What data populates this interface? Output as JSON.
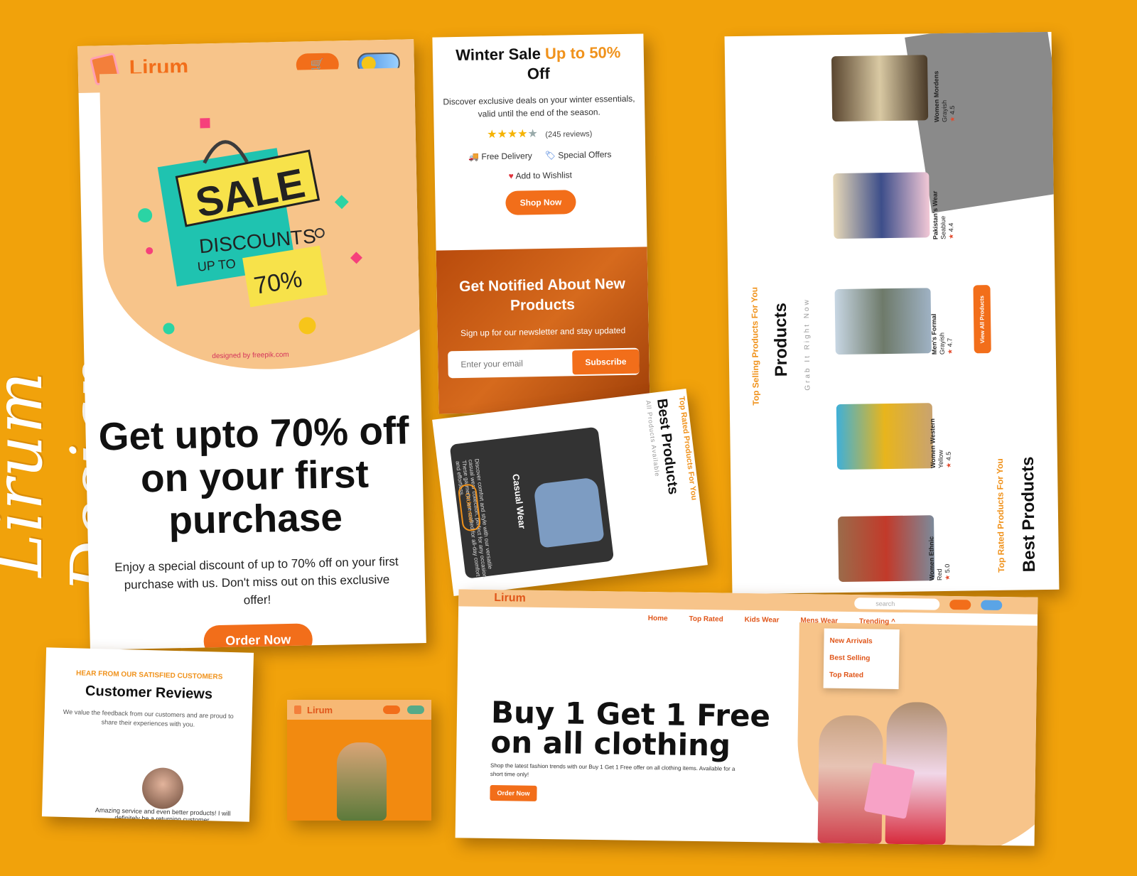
{
  "brand": {
    "side_title": "Lirum Design",
    "logo": "Lirum"
  },
  "mobile_hero": {
    "cart_icon": "cart-icon",
    "sale_title": "SALE",
    "sale_sub": "DISCOUNTS",
    "sale_upto": "UP TO",
    "sale_pct": "70%",
    "credit": "designed by freepik.com",
    "headline": "Get upto 70% off on your first purchase",
    "description": "Enjoy a special discount of up to 70% off on your first purchase with us. Don't miss out on this exclusive offer!",
    "cta": "Order Now"
  },
  "winter": {
    "title_a": "Winter Sale",
    "title_b": "Up to 50%",
    "title_c": "Off",
    "text": "Discover exclusive deals on your winter essentials, valid until the end of the season.",
    "stars": "★★★★",
    "star_gray": "★",
    "reviews": "(245 reviews)",
    "feature1": "Free Delivery",
    "feature2": "Special Offers",
    "wishlist": "Add to Wishlist",
    "cta": "Shop Now"
  },
  "newsletter": {
    "title": "Get Notified About New Products",
    "subtitle": "Sign up for our newsletter and stay updated",
    "placeholder": "Enter your email",
    "button": "Subscribe"
  },
  "best_card": {
    "overline": "Top Rated Products For You",
    "title": "Best Products",
    "hint": "All Products Available",
    "item_title": "Casual Wear",
    "item_desc": "Discover comfort and style with our versatile casual wear collection, perfect for any occasion. These garments are crafted for all-day comfort and effortless.",
    "cta": "Order now"
  },
  "product_list": {
    "overline": "Top Selling Products For You",
    "title": "Products",
    "hint": "Grab It Right Now",
    "view_all": "View All Products",
    "best_overline": "Top Rated Products For You",
    "best_title": "Best Products",
    "items": [
      {
        "name": "Women Mordens",
        "color": "Grayish",
        "rating": "4.5"
      },
      {
        "name": "Pakistan's Wear",
        "color": "Seablue",
        "rating": "4.4"
      },
      {
        "name": "Men's Formal",
        "color": "Grayish",
        "rating": "4.7"
      },
      {
        "name": "Women Western",
        "color": "Yellow",
        "rating": "4.5"
      },
      {
        "name": "Women Ethnic",
        "color": "Red",
        "rating": "5.0"
      }
    ]
  },
  "reviews": {
    "overline": "HEAR FROM OUR SATISFIED CUSTOMERS",
    "title": "Customer Reviews",
    "text": "We value the feedback from our customers and are proud to share their experiences with you.",
    "quote": "Amazing service and even better products! I will definitely be a returning customer."
  },
  "desktop": {
    "logo": "Lirum",
    "search_placeholder": "search",
    "menu": [
      "Home",
      "Top Rated",
      "Kids Wear",
      "Mens Wear",
      "Trending ^"
    ],
    "dropdown": [
      "New Arrivals",
      "Best Selling",
      "Top Rated"
    ],
    "headline1": "Buy 1 Get 1 Free",
    "headline2": "on all clothing",
    "description": "Shop the latest fashion trends with our Buy 1 Get 1 Free offer on all clothing items. Available for a short time only!",
    "cta": "Order Now"
  },
  "colors": {
    "background": "#f1a20b",
    "accent": "#f26e1a",
    "peach": "#f7c48a"
  }
}
